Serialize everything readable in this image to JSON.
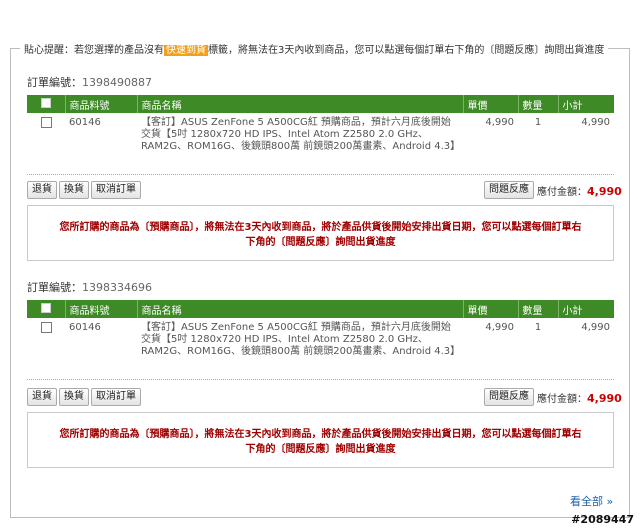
{
  "legend": {
    "prefix": "貼心提醒：若您選擇的產品沒有",
    "highlight": "快速到貨",
    "suffix": "標籤，將無法在3天內收到商品，您可以點選每個訂單右下角的〔問題反應〕詢問出貨進度"
  },
  "columns": [
    "商品料號",
    "商品名稱",
    "單價",
    "數量",
    "小計"
  ],
  "orders": [
    {
      "label": "訂單編號：",
      "number": "1398490887",
      "item": {
        "sku": "60146",
        "name": "【客訂】ASUS ZenFone 5 A500CG紅 預購商品，預計六月底後開始交貨【5吋 1280x720 HD IPS、Intel Atom Z2580 2.0 GHz、RAM2G、ROM16G、後鏡頭800萬 前鏡頭200萬畫素、Android 4.3】",
        "price": "4,990",
        "qty": "1",
        "subtotal": "4,990"
      },
      "buttons": {
        "return": "退貨",
        "exchange": "換貨",
        "cancel": "取消訂單",
        "issue": "問題反應"
      },
      "total_label": "應付金額：",
      "total": "4,990",
      "notice": "您所訂購的商品為〔預購商品〕，將無法在3天內收到商品，將於產品供貨後開始安排出貨日期，您可以點選每個訂單右下角的〔問題反應〕詢問出貨進度"
    },
    {
      "label": "訂單編號：",
      "number": "1398334696",
      "item": {
        "sku": "60146",
        "name": "【客訂】ASUS ZenFone 5 A500CG紅 預購商品，預計六月底後開始交貨【5吋 1280x720 HD IPS、Intel Atom Z2580 2.0 GHz、RAM2G、ROM16G、後鏡頭800萬 前鏡頭200萬畫素、Android 4.3】",
        "price": "4,990",
        "qty": "1",
        "subtotal": "4,990"
      },
      "buttons": {
        "return": "退貨",
        "exchange": "換貨",
        "cancel": "取消訂單",
        "issue": "問題反應"
      },
      "total_label": "應付金額：",
      "total": "4,990",
      "notice": "您所訂購的商品為〔預購商品〕，將無法在3天內收到商品，將於產品供貨後開始安排出貨日期，您可以點選每個訂單右下角的〔問題反應〕詢問出貨進度"
    }
  ],
  "more_link": "看全部 »",
  "watermark": "#2089447",
  "colors": {
    "header_green": "#3e8a26",
    "notice_red": "#a00000",
    "total_red": "#cc0000",
    "highlight_orange": "#f2a01c"
  }
}
